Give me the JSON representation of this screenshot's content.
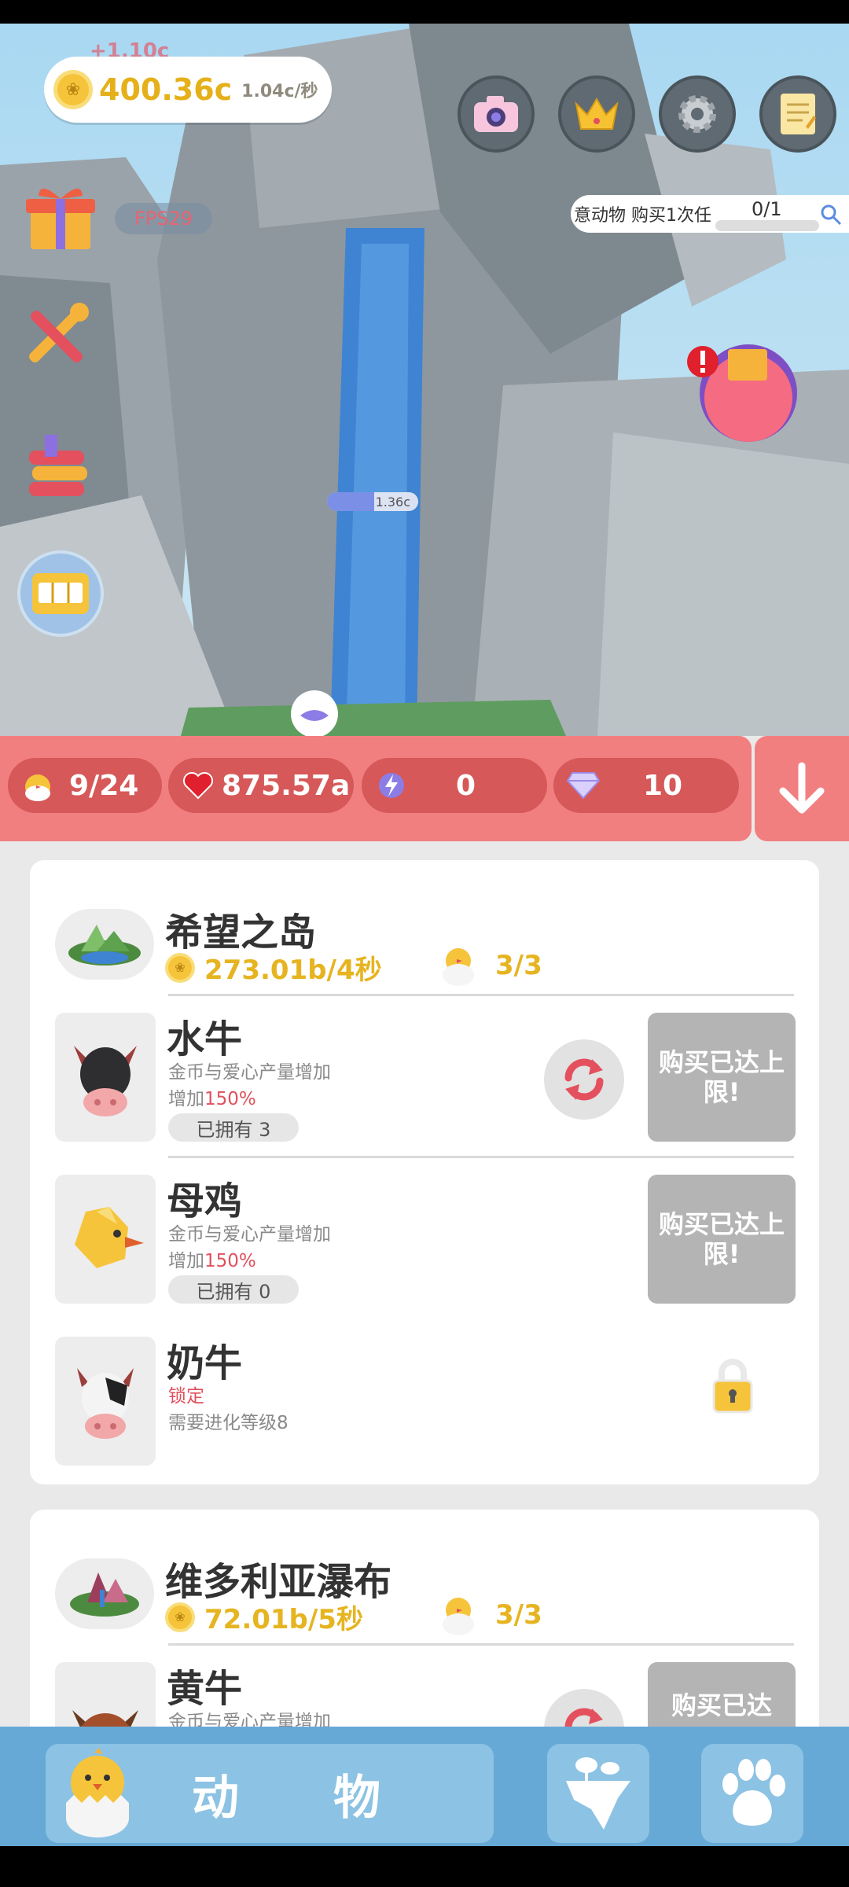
{
  "hud": {
    "coins": "400.36c",
    "coin_rate": "1.04c/秒",
    "floating_gain": "+1.10c",
    "fps": "FPS29",
    "quest_text": "意动物  购买1次任",
    "quest_progress": "0/1",
    "waterfall_amount": "1.36c"
  },
  "stats": {
    "animals": "9/24",
    "hearts": "875.57a",
    "energy": "0",
    "gems": "10"
  },
  "islands": [
    {
      "name": "希望之岛",
      "rate": "273.01b/4秒",
      "count": "3/3",
      "animals": [
        {
          "name": "水牛",
          "desc": "金币与爱心产量增加",
          "boost_prefix": "增加",
          "boost_pct": "150%",
          "owned": "已拥有 3",
          "buy_label": "购买已达上限!"
        },
        {
          "name": "母鸡",
          "desc": "金币与爱心产量增加",
          "boost_prefix": "增加",
          "boost_pct": "150%",
          "owned": "已拥有 0",
          "buy_label": "购买已达上限!"
        },
        {
          "name": "奶牛",
          "status": "锁定",
          "requirement": "需要进化等级8"
        }
      ]
    },
    {
      "name": "维多利亚瀑布",
      "rate": "72.01b/5秒",
      "count": "3/3",
      "animals": [
        {
          "name": "黄牛",
          "desc": "金币与爱心产量增加",
          "buy_label": "购买已达"
        }
      ]
    }
  ],
  "nav": {
    "main_label": "动物"
  }
}
